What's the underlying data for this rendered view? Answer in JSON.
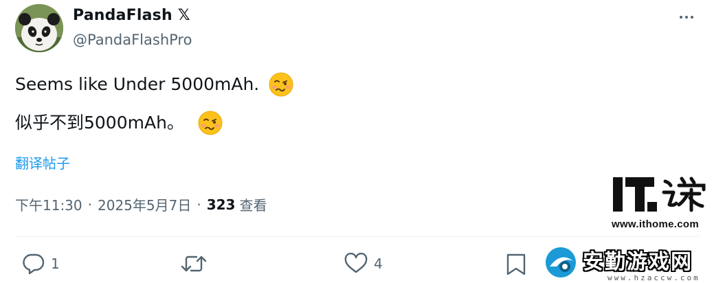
{
  "author": {
    "display_name": "PandaFlash",
    "verified_badge": "𝕏",
    "handle": "@PandaFlashPro",
    "avatar_icon": "panda-avatar"
  },
  "tweet": {
    "line1": "Seems like Under 5000mAh.",
    "line2": "似乎不到5000mAh。",
    "emoji_icon": "woozy-face-emoji"
  },
  "translate_label": "翻译帖子",
  "meta": {
    "time": "下午11:30",
    "separator": "·",
    "date": "2025年5月7日",
    "views_count": "323",
    "views_label": "查看"
  },
  "actions": {
    "reply_count": "1",
    "repost_count": "",
    "like_count": "4"
  },
  "watermarks": {
    "ithome_url": "www.ithome.com",
    "hzaccw_title": "安勤游戏网",
    "hzaccw_url": "www.hzaccw.com"
  },
  "colors": {
    "text_primary": "#0f1419",
    "text_secondary": "#536471",
    "link": "#1d9bf0",
    "divider": "#eff3f4"
  }
}
